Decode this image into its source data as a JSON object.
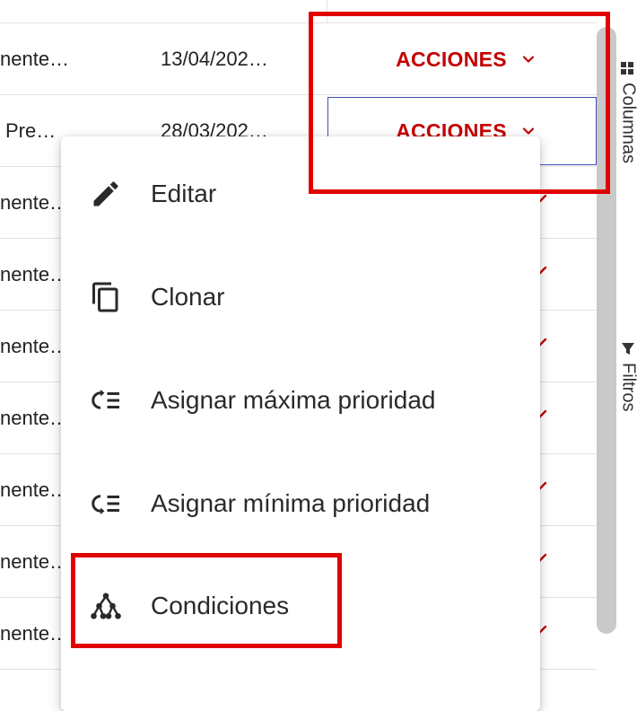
{
  "table": {
    "rows": [
      {
        "name": "nente…",
        "date": "13/04/202…",
        "actions": "ACCIONES"
      },
      {
        "name": "Pre…",
        "date": "28/03/202…",
        "actions": "ACCIONES"
      },
      {
        "name": "nente…",
        "date": ""
      },
      {
        "name": "nente…",
        "date": ""
      },
      {
        "name": "nente…",
        "date": ""
      },
      {
        "name": "nente…",
        "date": ""
      },
      {
        "name": "nente…",
        "date": ""
      },
      {
        "name": "nente…",
        "date": ""
      },
      {
        "name": "nente…",
        "date": ""
      }
    ]
  },
  "side_panel": {
    "columns_label": "Columnas",
    "filters_label": "Filtros"
  },
  "menu": {
    "items": [
      {
        "label": "Editar",
        "icon": "pencil-icon"
      },
      {
        "label": "Clonar",
        "icon": "copy-icon"
      },
      {
        "label": "Asignar máxima prioridad",
        "icon": "priority-list-icon"
      },
      {
        "label": "Asignar mínima prioridad",
        "icon": "priority-list-icon"
      },
      {
        "label": "Condiciones",
        "icon": "tree-nodes-icon"
      }
    ]
  },
  "colors": {
    "accent": "#c40000",
    "highlight": "#e00000",
    "selection": "#3f51b5"
  }
}
